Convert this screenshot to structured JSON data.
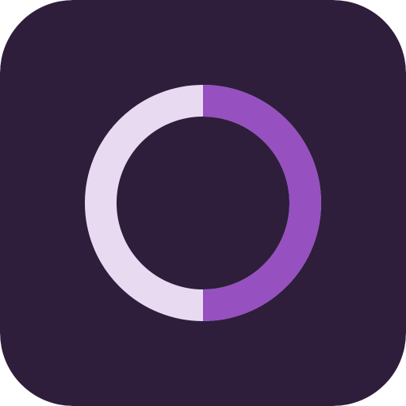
{
  "app_icon": {
    "icon_name": "half-filled-ring-icon",
    "colors": {
      "background": "#2e1e3b",
      "ring_track": "#e8dbf1",
      "ring_fill": "#9650c0"
    },
    "progress": 0.5
  }
}
